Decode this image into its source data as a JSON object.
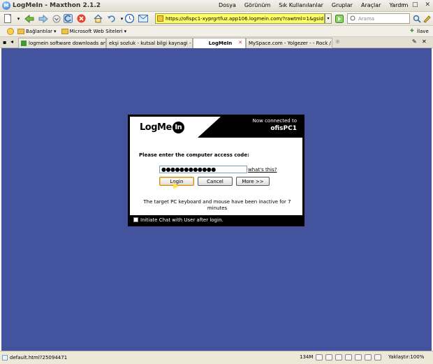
{
  "window": {
    "app_icon_letter": "M",
    "title": "LogMeIn - Maxthon 2.1.2",
    "min_glyph": "─",
    "max_glyph": "□",
    "close_glyph": "✕"
  },
  "menu": [
    "Dosya",
    "Görünüm",
    "Sık Kullanılanlar",
    "Gruplar",
    "Araçlar",
    "Yardım"
  ],
  "toolbar": {
    "address": "https://ofispc1-xyprgrtfuz.app106.logmein.com/?rawtml=1&gsid=_",
    "search_placeholder": "Arama",
    "go_glyph": "▶"
  },
  "bookmarks": {
    "connections": "Bağlantılar",
    "web_sites": "Microsoft Web Siteleri",
    "plugins": "İlave"
  },
  "tabs": [
    {
      "label": "logmein software downloads and..."
    },
    {
      "label": "ekşi sozluk - kutsal bilgi kaynagi - log..."
    },
    {
      "label": "LogMeIn"
    },
    {
      "label": "MySpace.com - Yolgezer - - Rock / A..."
    }
  ],
  "dialog": {
    "logo_text": "LogMe",
    "logo_in": "In",
    "now_connected": "Now connected to",
    "pc_name": "ofisPC1",
    "prompt": "Please enter the computer access code:",
    "password_dots": "●●●●●●●●●●●●",
    "whats_this": "what's this?",
    "login": "Login",
    "cancel": "Cancel",
    "more": "More >>",
    "note": "The target PC keyboard and mouse have been inactive for 7 minutes",
    "chat_label": "Initiate Chat with User after login."
  },
  "status": {
    "url": "default.html?25094471",
    "memory": "134M",
    "zoom": "Yaklaştır:100%"
  }
}
